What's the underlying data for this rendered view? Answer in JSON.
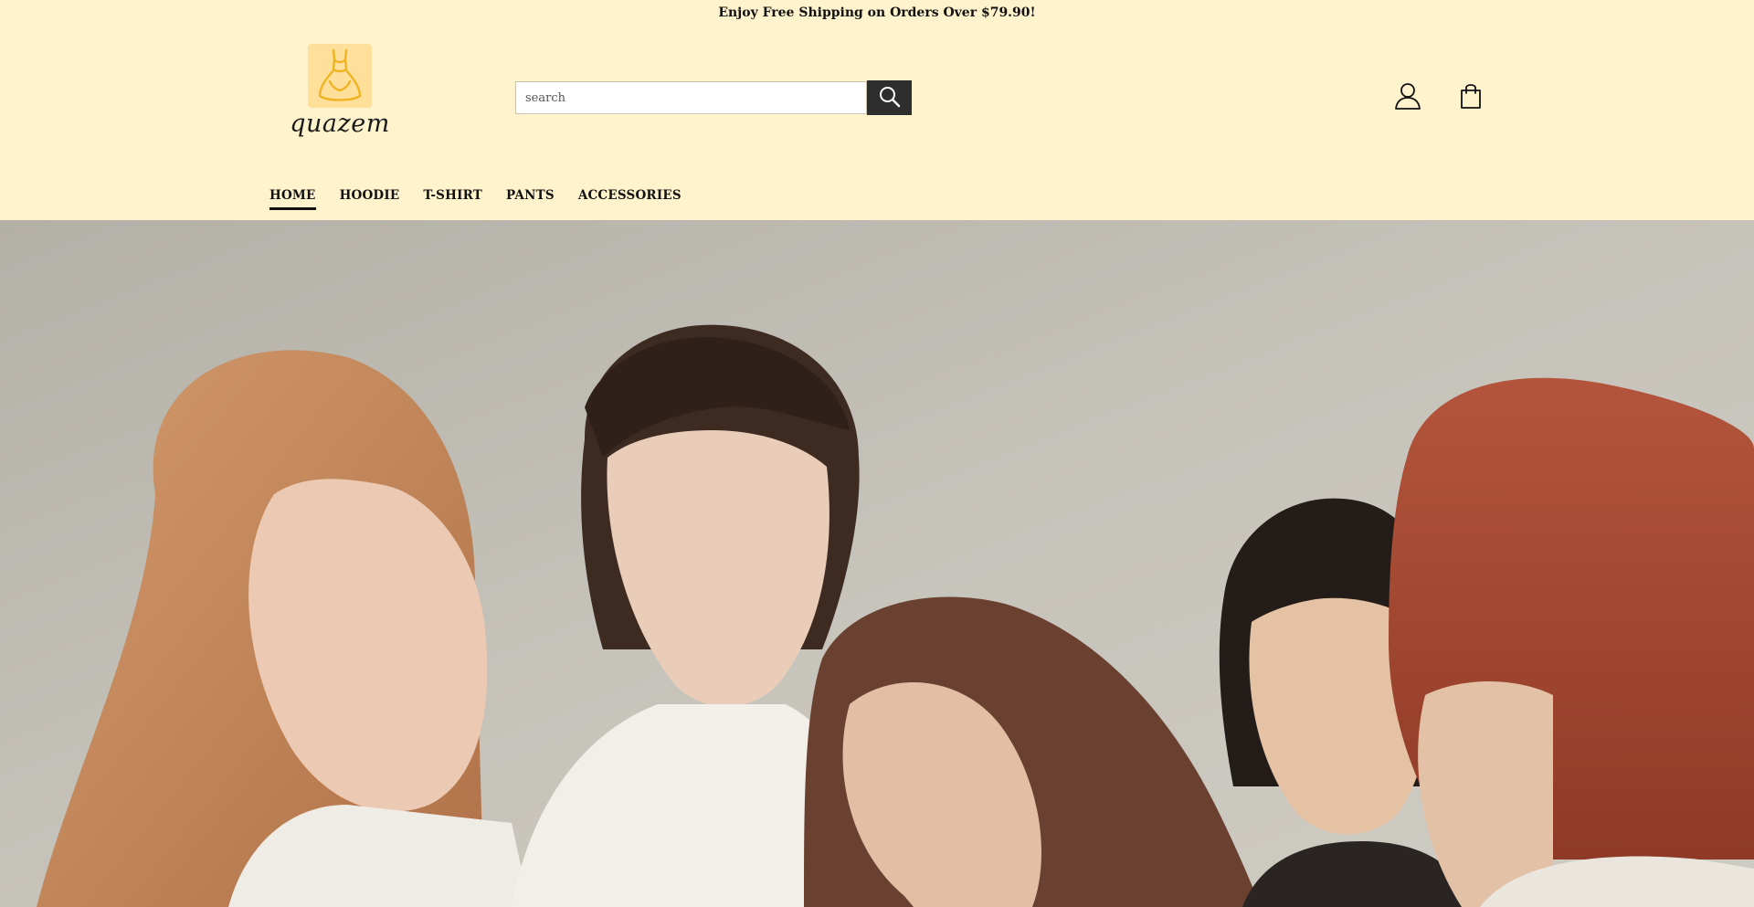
{
  "announcement": {
    "text": "Enjoy Free Shipping on Orders Over $79.90!"
  },
  "brand": {
    "name": "quazem",
    "logo_icon": "dress-icon",
    "accent": "#ffe09a"
  },
  "search": {
    "placeholder": "search",
    "value": "",
    "button_icon": "search-icon"
  },
  "header_icons": {
    "account_icon": "user-icon",
    "cart_icon": "shopping-bag-icon"
  },
  "nav": {
    "items": [
      {
        "label": "HOME",
        "active": true
      },
      {
        "label": "HOODIE",
        "active": false
      },
      {
        "label": "T-SHIRT",
        "active": false
      },
      {
        "label": "PANTS",
        "active": false
      },
      {
        "label": "ACCESSORIES",
        "active": false
      }
    ]
  },
  "colors": {
    "header_bg": "#fff3cd",
    "search_button_bg": "#2e2e2e",
    "text": "#111111"
  }
}
